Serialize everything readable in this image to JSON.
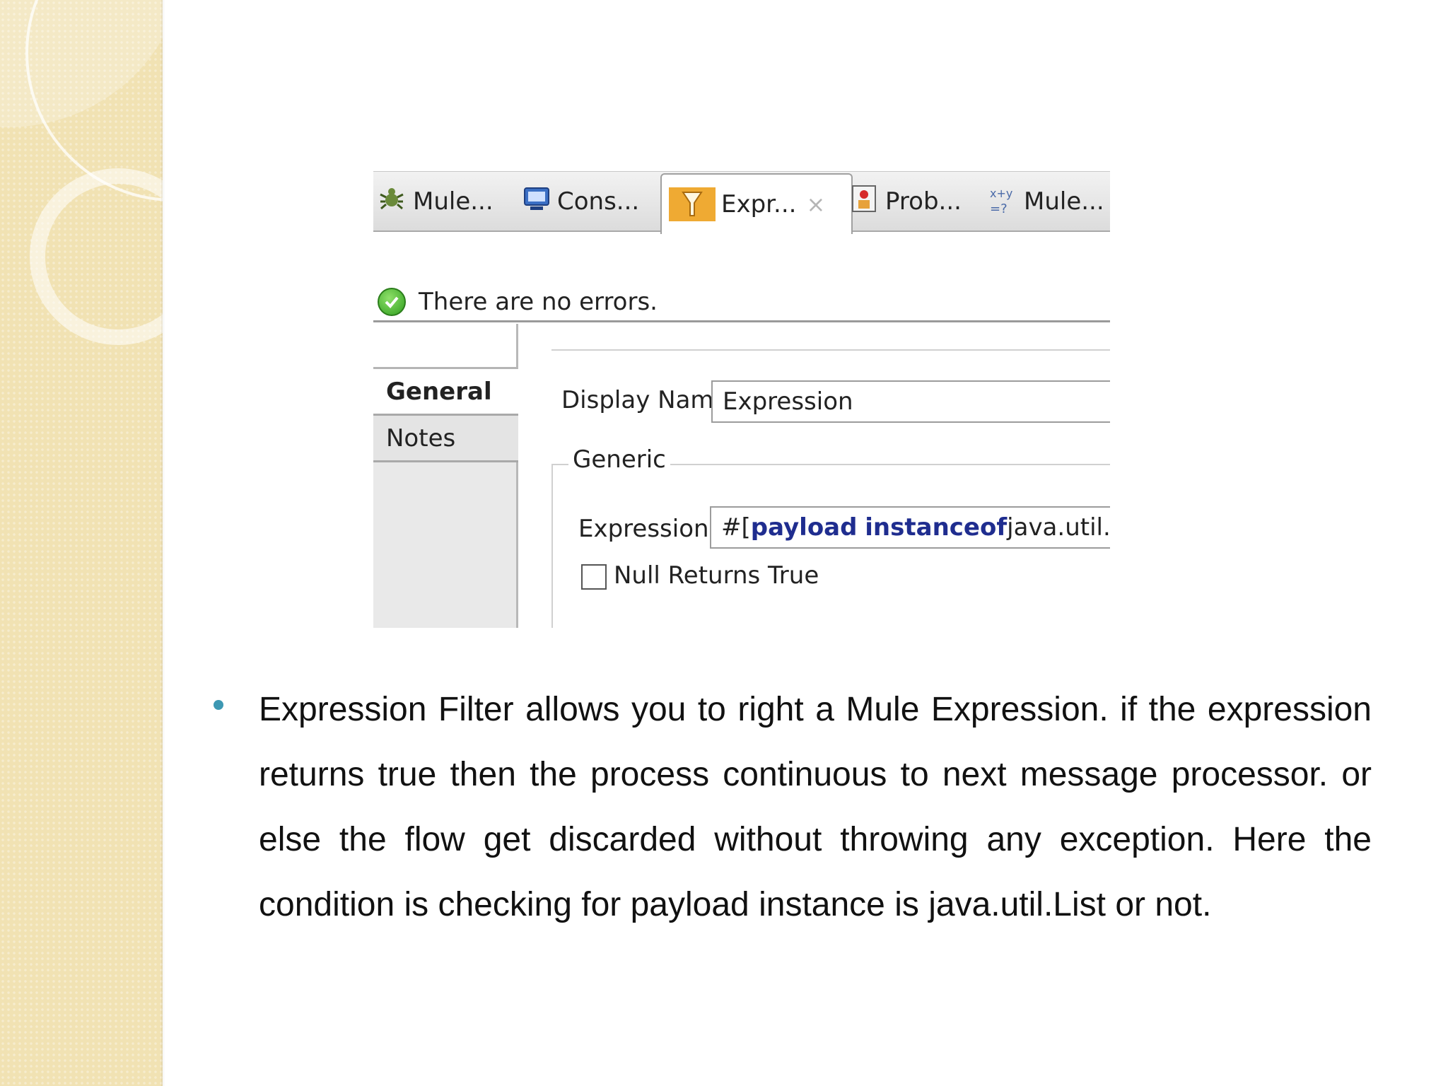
{
  "tabs": [
    {
      "label": "Mule...",
      "icon": "bug-icon"
    },
    {
      "label": "Cons...",
      "icon": "console-icon"
    },
    {
      "label": "Expr...",
      "icon": "filter-icon",
      "active": true,
      "close": "×"
    },
    {
      "label": "Prob...",
      "icon": "problems-icon"
    },
    {
      "label": "Mule...",
      "icon": "expression-evaluator-icon"
    }
  ],
  "status": {
    "message": "There are no errors.",
    "icon": "check-circle-icon",
    "color": "#2f9f1e"
  },
  "side_nav": {
    "items": [
      "General",
      "Notes"
    ],
    "selected": "General"
  },
  "form": {
    "display_name_label": "Display Name:",
    "display_name_value": "Expression",
    "group_label": "Generic",
    "expression_label": "Expression:",
    "expression_value": {
      "prefix": "#[",
      "keyword1": "payload",
      "keyword2": "instanceof",
      "rest": " java.util.List]"
    },
    "null_returns_label": "Null Returns True",
    "null_returns_checked": false
  },
  "body_text": "Expression Filter allows you to right a Mule Expression. if the expression returns true then the process continuous to next message processor.  or else the flow get discarded without throwing any exception. Here the condition is checking for payload instance is java.util.List or not.",
  "colors": {
    "accent_tab": "#efaa33",
    "bullet": "#3d98b3",
    "keyword": "#1f2d8f",
    "deco": "#f1e2b3"
  }
}
